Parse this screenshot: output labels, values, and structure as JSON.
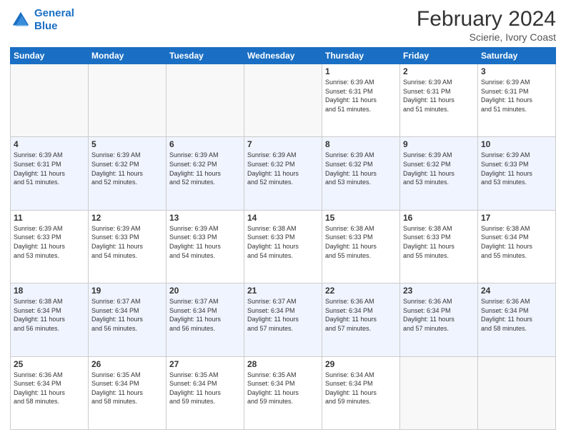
{
  "header": {
    "logo_line1": "General",
    "logo_line2": "Blue",
    "month_year": "February 2024",
    "location": "Scierie, Ivory Coast"
  },
  "weekdays": [
    "Sunday",
    "Monday",
    "Tuesday",
    "Wednesday",
    "Thursday",
    "Friday",
    "Saturday"
  ],
  "weeks": [
    [
      {
        "day": "",
        "info": ""
      },
      {
        "day": "",
        "info": ""
      },
      {
        "day": "",
        "info": ""
      },
      {
        "day": "",
        "info": ""
      },
      {
        "day": "1",
        "info": "Sunrise: 6:39 AM\nSunset: 6:31 PM\nDaylight: 11 hours\nand 51 minutes."
      },
      {
        "day": "2",
        "info": "Sunrise: 6:39 AM\nSunset: 6:31 PM\nDaylight: 11 hours\nand 51 minutes."
      },
      {
        "day": "3",
        "info": "Sunrise: 6:39 AM\nSunset: 6:31 PM\nDaylight: 11 hours\nand 51 minutes."
      }
    ],
    [
      {
        "day": "4",
        "info": "Sunrise: 6:39 AM\nSunset: 6:31 PM\nDaylight: 11 hours\nand 51 minutes."
      },
      {
        "day": "5",
        "info": "Sunrise: 6:39 AM\nSunset: 6:32 PM\nDaylight: 11 hours\nand 52 minutes."
      },
      {
        "day": "6",
        "info": "Sunrise: 6:39 AM\nSunset: 6:32 PM\nDaylight: 11 hours\nand 52 minutes."
      },
      {
        "day": "7",
        "info": "Sunrise: 6:39 AM\nSunset: 6:32 PM\nDaylight: 11 hours\nand 52 minutes."
      },
      {
        "day": "8",
        "info": "Sunrise: 6:39 AM\nSunset: 6:32 PM\nDaylight: 11 hours\nand 53 minutes."
      },
      {
        "day": "9",
        "info": "Sunrise: 6:39 AM\nSunset: 6:32 PM\nDaylight: 11 hours\nand 53 minutes."
      },
      {
        "day": "10",
        "info": "Sunrise: 6:39 AM\nSunset: 6:33 PM\nDaylight: 11 hours\nand 53 minutes."
      }
    ],
    [
      {
        "day": "11",
        "info": "Sunrise: 6:39 AM\nSunset: 6:33 PM\nDaylight: 11 hours\nand 53 minutes."
      },
      {
        "day": "12",
        "info": "Sunrise: 6:39 AM\nSunset: 6:33 PM\nDaylight: 11 hours\nand 54 minutes."
      },
      {
        "day": "13",
        "info": "Sunrise: 6:39 AM\nSunset: 6:33 PM\nDaylight: 11 hours\nand 54 minutes."
      },
      {
        "day": "14",
        "info": "Sunrise: 6:38 AM\nSunset: 6:33 PM\nDaylight: 11 hours\nand 54 minutes."
      },
      {
        "day": "15",
        "info": "Sunrise: 6:38 AM\nSunset: 6:33 PM\nDaylight: 11 hours\nand 55 minutes."
      },
      {
        "day": "16",
        "info": "Sunrise: 6:38 AM\nSunset: 6:33 PM\nDaylight: 11 hours\nand 55 minutes."
      },
      {
        "day": "17",
        "info": "Sunrise: 6:38 AM\nSunset: 6:34 PM\nDaylight: 11 hours\nand 55 minutes."
      }
    ],
    [
      {
        "day": "18",
        "info": "Sunrise: 6:38 AM\nSunset: 6:34 PM\nDaylight: 11 hours\nand 56 minutes."
      },
      {
        "day": "19",
        "info": "Sunrise: 6:37 AM\nSunset: 6:34 PM\nDaylight: 11 hours\nand 56 minutes."
      },
      {
        "day": "20",
        "info": "Sunrise: 6:37 AM\nSunset: 6:34 PM\nDaylight: 11 hours\nand 56 minutes."
      },
      {
        "day": "21",
        "info": "Sunrise: 6:37 AM\nSunset: 6:34 PM\nDaylight: 11 hours\nand 57 minutes."
      },
      {
        "day": "22",
        "info": "Sunrise: 6:36 AM\nSunset: 6:34 PM\nDaylight: 11 hours\nand 57 minutes."
      },
      {
        "day": "23",
        "info": "Sunrise: 6:36 AM\nSunset: 6:34 PM\nDaylight: 11 hours\nand 57 minutes."
      },
      {
        "day": "24",
        "info": "Sunrise: 6:36 AM\nSunset: 6:34 PM\nDaylight: 11 hours\nand 58 minutes."
      }
    ],
    [
      {
        "day": "25",
        "info": "Sunrise: 6:36 AM\nSunset: 6:34 PM\nDaylight: 11 hours\nand 58 minutes."
      },
      {
        "day": "26",
        "info": "Sunrise: 6:35 AM\nSunset: 6:34 PM\nDaylight: 11 hours\nand 58 minutes."
      },
      {
        "day": "27",
        "info": "Sunrise: 6:35 AM\nSunset: 6:34 PM\nDaylight: 11 hours\nand 59 minutes."
      },
      {
        "day": "28",
        "info": "Sunrise: 6:35 AM\nSunset: 6:34 PM\nDaylight: 11 hours\nand 59 minutes."
      },
      {
        "day": "29",
        "info": "Sunrise: 6:34 AM\nSunset: 6:34 PM\nDaylight: 11 hours\nand 59 minutes."
      },
      {
        "day": "",
        "info": ""
      },
      {
        "day": "",
        "info": ""
      }
    ]
  ]
}
